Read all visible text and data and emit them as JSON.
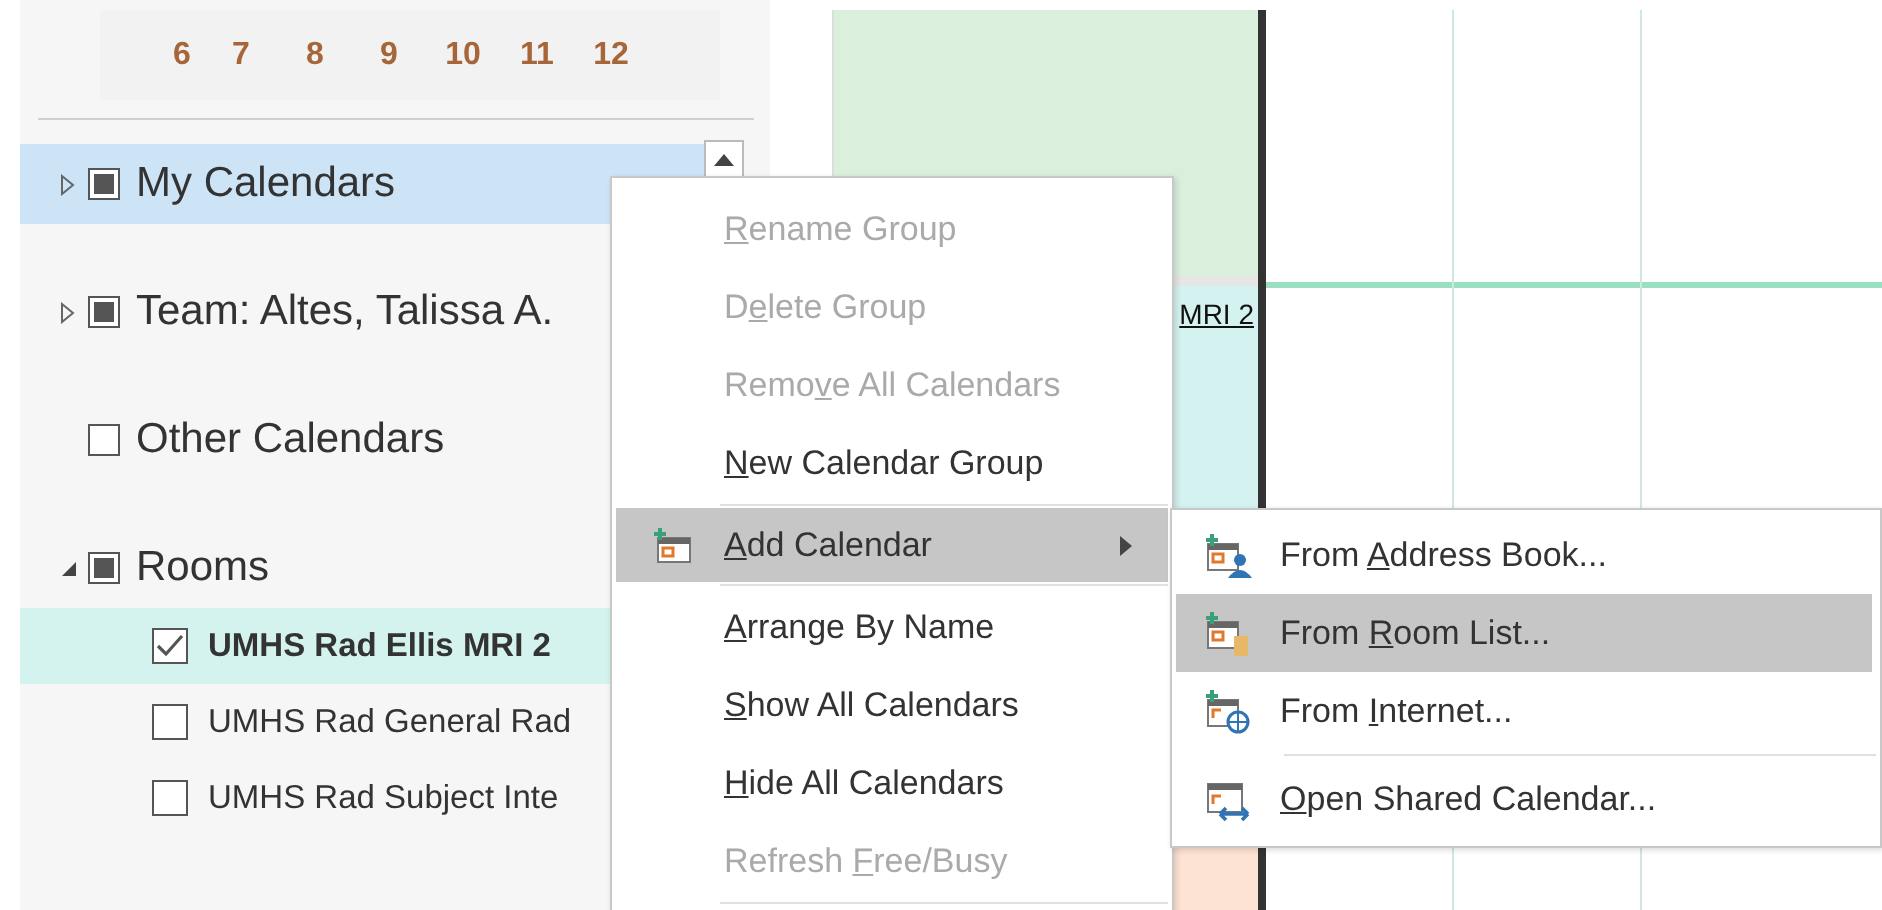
{
  "mini_calendar": {
    "days": [
      "6",
      "7",
      "8",
      "9",
      "10",
      "11",
      "12"
    ]
  },
  "calendar_groups": [
    {
      "label": "My Calendars",
      "expandable": true,
      "expanded": false,
      "checked": true,
      "selected": true
    },
    {
      "label": "Team: Altes, Talissa A.",
      "expandable": true,
      "expanded": false,
      "checked": true,
      "selected": false
    },
    {
      "label": "Other Calendars",
      "expandable": false,
      "checked": false,
      "selected": false
    },
    {
      "label": "Rooms",
      "expandable": true,
      "expanded": true,
      "checked": true,
      "selected": false,
      "children": [
        {
          "label": "UMHS Rad Ellis MRI 2",
          "checked": true,
          "selected": true
        },
        {
          "label": "UMHS Rad General Rad",
          "checked": false,
          "selected": false
        },
        {
          "label": "UMHS Rad Subject Inte",
          "checked": false,
          "selected": false
        }
      ]
    }
  ],
  "calendar_event": {
    "title": "MRI 2"
  },
  "context_menu": [
    {
      "kind": "item",
      "key": "R",
      "after": "ename Group",
      "disabled": true,
      "highlighted": false,
      "submenu": false
    },
    {
      "kind": "item",
      "before": "D",
      "key": "e",
      "after": "lete Group",
      "disabled": true,
      "highlighted": false,
      "submenu": false
    },
    {
      "kind": "item",
      "before": "Remo",
      "key": "v",
      "after": "e All Calendars",
      "disabled": true,
      "highlighted": false,
      "submenu": false
    },
    {
      "kind": "item",
      "key": "N",
      "after": "ew Calendar Group",
      "disabled": false,
      "highlighted": false,
      "submenu": false
    },
    {
      "kind": "separator"
    },
    {
      "kind": "icon_item",
      "key": "A",
      "after": "dd Calendar",
      "disabled": false,
      "highlighted": true,
      "submenu": true
    },
    {
      "kind": "separator"
    },
    {
      "kind": "item",
      "key": "A",
      "after": "rrange By Name",
      "disabled": false,
      "highlighted": false,
      "submenu": false
    },
    {
      "kind": "item",
      "key": "S",
      "after": "how All Calendars",
      "disabled": false,
      "highlighted": false,
      "submenu": false
    },
    {
      "kind": "item",
      "key": "H",
      "after": "ide All Calendars",
      "disabled": false,
      "highlighted": false,
      "submenu": false
    },
    {
      "kind": "item",
      "before": "Refresh ",
      "key": "F",
      "after": "ree/Busy",
      "disabled": true,
      "highlighted": false,
      "submenu": false
    },
    {
      "kind": "separator"
    }
  ],
  "submenu": [
    {
      "kind": "item",
      "before": "From ",
      "key": "A",
      "after": "ddress Book...",
      "highlighted": false
    },
    {
      "kind": "item",
      "before": "From ",
      "key": "R",
      "after": "oom List...",
      "highlighted": true
    },
    {
      "kind": "item",
      "before": "From ",
      "key": "I",
      "after": "nternet...",
      "highlighted": false
    },
    {
      "kind": "separator"
    },
    {
      "kind": "item",
      "key": "O",
      "after": "pen Shared Calendar...",
      "highlighted": false
    }
  ]
}
